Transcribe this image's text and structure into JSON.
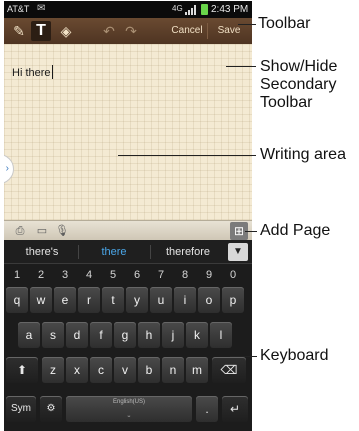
{
  "status_bar": {
    "carrier": "AT&T",
    "network": "4G",
    "time": "2:43 PM"
  },
  "toolbar": {
    "cancel_label": "Cancel",
    "save_label": "Save"
  },
  "writing_area": {
    "text": "Hi there"
  },
  "suggestions": [
    "there's",
    "there",
    "therefore"
  ],
  "keyboard": {
    "number_row": [
      "1",
      "2",
      "3",
      "4",
      "5",
      "6",
      "7",
      "8",
      "9",
      "0"
    ],
    "row1": [
      "q",
      "w",
      "e",
      "r",
      "t",
      "y",
      "u",
      "i",
      "o",
      "p"
    ],
    "row2": [
      "a",
      "s",
      "d",
      "f",
      "g",
      "h",
      "j",
      "k",
      "l"
    ],
    "row3": [
      "z",
      "x",
      "c",
      "v",
      "b",
      "n",
      "m"
    ],
    "sym_label": "Sym",
    "space_label": "English(US)",
    "period_label": "."
  },
  "callouts": {
    "toolbar": "Toolbar",
    "show_hide": "Show/Hide Secondary Toolbar",
    "writing_area": "Writing area",
    "add_page": "Add Page",
    "keyboard": "Keyboard"
  },
  "icons": [
    "pen-icon",
    "text-icon",
    "eraser-icon",
    "undo-icon",
    "redo-icon",
    "toolbar-toggle-icon",
    "insert-image-icon",
    "voice-icon",
    "add-page-icon",
    "chevron-down-icon",
    "shift-icon",
    "delete-icon",
    "settings-icon",
    "enter-icon"
  ]
}
